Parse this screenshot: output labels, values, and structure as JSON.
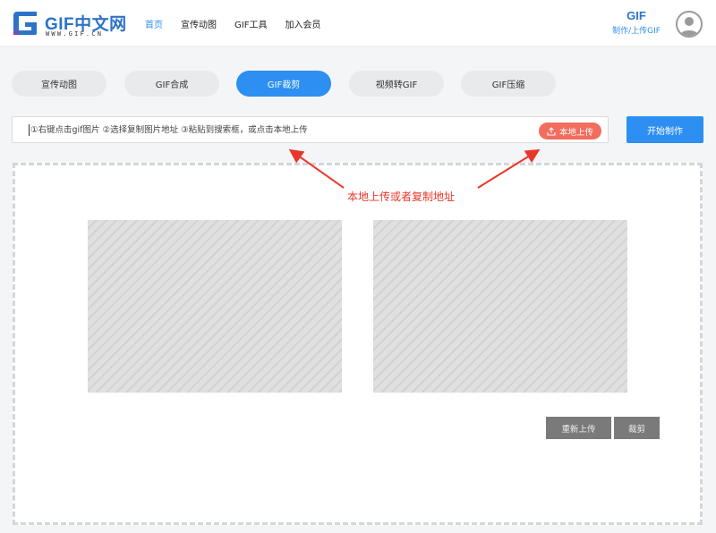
{
  "logo": {
    "title": "GIF中文网",
    "subtitle": "WWW.GIF.CN"
  },
  "nav": {
    "items": [
      "首页",
      "宣传动图",
      "GIF工具",
      "加入会员"
    ],
    "active_index": 0
  },
  "gif_maker": {
    "badge": "GIF",
    "text": "制作/上传GIF"
  },
  "tabs": [
    {
      "label": "宣传动图",
      "active": false
    },
    {
      "label": "GIF合成",
      "active": false
    },
    {
      "label": "GIF裁剪",
      "active": true
    },
    {
      "label": "视频转GIF",
      "active": false
    },
    {
      "label": "GIF压缩",
      "active": false
    }
  ],
  "url_input": {
    "placeholder": "①右键点击gif图片 ②选择复制图片地址 ③粘贴到搜索框，或点击本地上传",
    "value": ""
  },
  "upload_button": {
    "label": "本地上传",
    "icon": "upload-icon"
  },
  "start_button": {
    "label": "开始制作"
  },
  "annotation": {
    "text": "本地上传或者复制地址"
  },
  "actions": {
    "reupload_label": "重新上传",
    "crop_label": "裁剪"
  },
  "colors": {
    "accent": "#2c8ff1",
    "upload": "#f16d5e",
    "annotation": "#e8372a",
    "grey_button": "#7a7a7a"
  }
}
